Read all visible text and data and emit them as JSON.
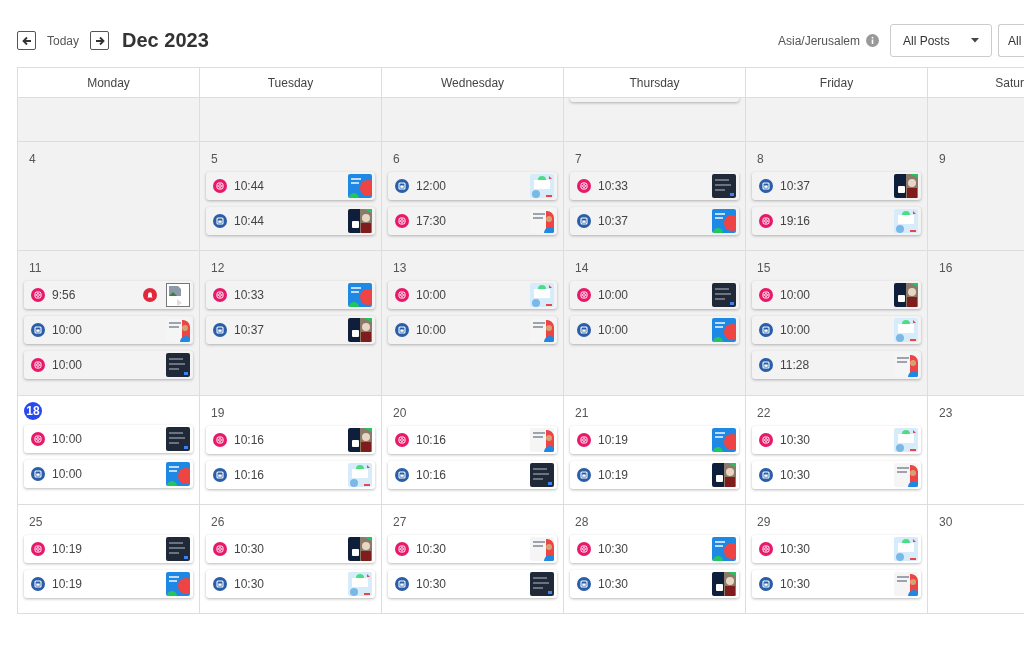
{
  "toolbar": {
    "today_label": "Today",
    "month": "Dec 2023",
    "timezone": "Asia/Jerusalem",
    "post_filter": "All Posts",
    "second_filter": "All"
  },
  "weekdays": [
    "Monday",
    "Tuesday",
    "Wednesday",
    "Thursday",
    "Friday",
    "Satur"
  ],
  "weeks": [
    {
      "past": true,
      "days": [
        {
          "cut_off_post": false
        },
        {
          "cut_off_post": false
        },
        {
          "cut_off_post": false
        },
        {
          "cut_off_post": true
        },
        {
          "cut_off_post": false
        },
        {
          "cut_off_post": false
        }
      ]
    },
    {
      "past": true,
      "days": [
        {
          "date": "4",
          "today": false
        },
        {
          "date": "5",
          "today": false,
          "posts": [
            {
              "kind": "instagram",
              "time": "10:44",
              "alert": false
            },
            {
              "kind": "linkedin",
              "time": "10:44",
              "alert": false
            }
          ]
        },
        {
          "date": "6",
          "today": false,
          "posts": [
            {
              "kind": "linkedin",
              "time": "12:00",
              "alert": false
            },
            {
              "kind": "instagram",
              "time": "17:30",
              "alert": false
            }
          ]
        },
        {
          "date": "7",
          "today": false,
          "posts": [
            {
              "kind": "instagram",
              "time": "10:33",
              "alert": false
            },
            {
              "kind": "linkedin",
              "time": "10:37",
              "alert": false
            }
          ]
        },
        {
          "date": "8",
          "today": false,
          "posts": [
            {
              "kind": "linkedin",
              "time": "10:37",
              "alert": false
            },
            {
              "kind": "instagram",
              "time": "19:16",
              "alert": false
            }
          ]
        },
        {
          "date": "9",
          "today": false
        }
      ]
    },
    {
      "past": true,
      "days": [
        {
          "date": "11",
          "today": false,
          "posts": [
            {
              "kind": "instagram",
              "time": "9:56",
              "alert": true
            },
            {
              "kind": "linkedin",
              "time": "10:00",
              "alert": false
            },
            {
              "kind": "instagram",
              "time": "10:00",
              "alert": false
            }
          ]
        },
        {
          "date": "12",
          "today": false,
          "posts": [
            {
              "kind": "instagram",
              "time": "10:33",
              "alert": false
            },
            {
              "kind": "linkedin",
              "time": "10:37",
              "alert": false
            }
          ]
        },
        {
          "date": "13",
          "today": false,
          "posts": [
            {
              "kind": "instagram",
              "time": "10:00",
              "alert": false
            },
            {
              "kind": "linkedin",
              "time": "10:00",
              "alert": false
            }
          ]
        },
        {
          "date": "14",
          "today": false,
          "posts": [
            {
              "kind": "instagram",
              "time": "10:00",
              "alert": false
            },
            {
              "kind": "linkedin",
              "time": "10:00",
              "alert": false
            }
          ]
        },
        {
          "date": "15",
          "today": false,
          "posts": [
            {
              "kind": "instagram",
              "time": "10:00",
              "alert": false
            },
            {
              "kind": "linkedin",
              "time": "10:00",
              "alert": false
            },
            {
              "kind": "linkedin",
              "time": "11:28",
              "alert": false
            }
          ]
        },
        {
          "date": "16",
          "today": false
        }
      ]
    },
    {
      "past": false,
      "days": [
        {
          "date": "18",
          "today": true,
          "posts": [
            {
              "kind": "instagram",
              "time": "10:00",
              "alert": false
            },
            {
              "kind": "linkedin",
              "time": "10:00",
              "alert": false
            }
          ]
        },
        {
          "date": "19",
          "today": false,
          "posts": [
            {
              "kind": "instagram",
              "time": "10:16",
              "alert": false
            },
            {
              "kind": "linkedin",
              "time": "10:16",
              "alert": false
            }
          ]
        },
        {
          "date": "20",
          "today": false,
          "posts": [
            {
              "kind": "instagram",
              "time": "10:16",
              "alert": false
            },
            {
              "kind": "linkedin",
              "time": "10:16",
              "alert": false
            }
          ]
        },
        {
          "date": "21",
          "today": false,
          "posts": [
            {
              "kind": "instagram",
              "time": "10:19",
              "alert": false
            },
            {
              "kind": "linkedin",
              "time": "10:19",
              "alert": false
            }
          ]
        },
        {
          "date": "22",
          "today": false,
          "posts": [
            {
              "kind": "instagram",
              "time": "10:30",
              "alert": false
            },
            {
              "kind": "linkedin",
              "time": "10:30",
              "alert": false
            }
          ]
        },
        {
          "date": "23",
          "today": false
        }
      ]
    },
    {
      "past": false,
      "days": [
        {
          "date": "25",
          "today": false,
          "posts": [
            {
              "kind": "instagram",
              "time": "10:19",
              "alert": false
            },
            {
              "kind": "linkedin",
              "time": "10:19",
              "alert": false
            }
          ]
        },
        {
          "date": "26",
          "today": false,
          "posts": [
            {
              "kind": "instagram",
              "time": "10:30",
              "alert": false
            },
            {
              "kind": "linkedin",
              "time": "10:30",
              "alert": false
            }
          ]
        },
        {
          "date": "27",
          "today": false,
          "posts": [
            {
              "kind": "instagram",
              "time": "10:30",
              "alert": false
            },
            {
              "kind": "linkedin",
              "time": "10:30",
              "alert": false
            }
          ]
        },
        {
          "date": "28",
          "today": false,
          "posts": [
            {
              "kind": "instagram",
              "time": "10:30",
              "alert": false
            },
            {
              "kind": "linkedin",
              "time": "10:30",
              "alert": false
            }
          ]
        },
        {
          "date": "29",
          "today": false,
          "posts": [
            {
              "kind": "instagram",
              "time": "10:30",
              "alert": false
            },
            {
              "kind": "linkedin",
              "time": "10:30",
              "alert": false
            }
          ]
        },
        {
          "date": "30",
          "today": false
        }
      ]
    }
  ]
}
